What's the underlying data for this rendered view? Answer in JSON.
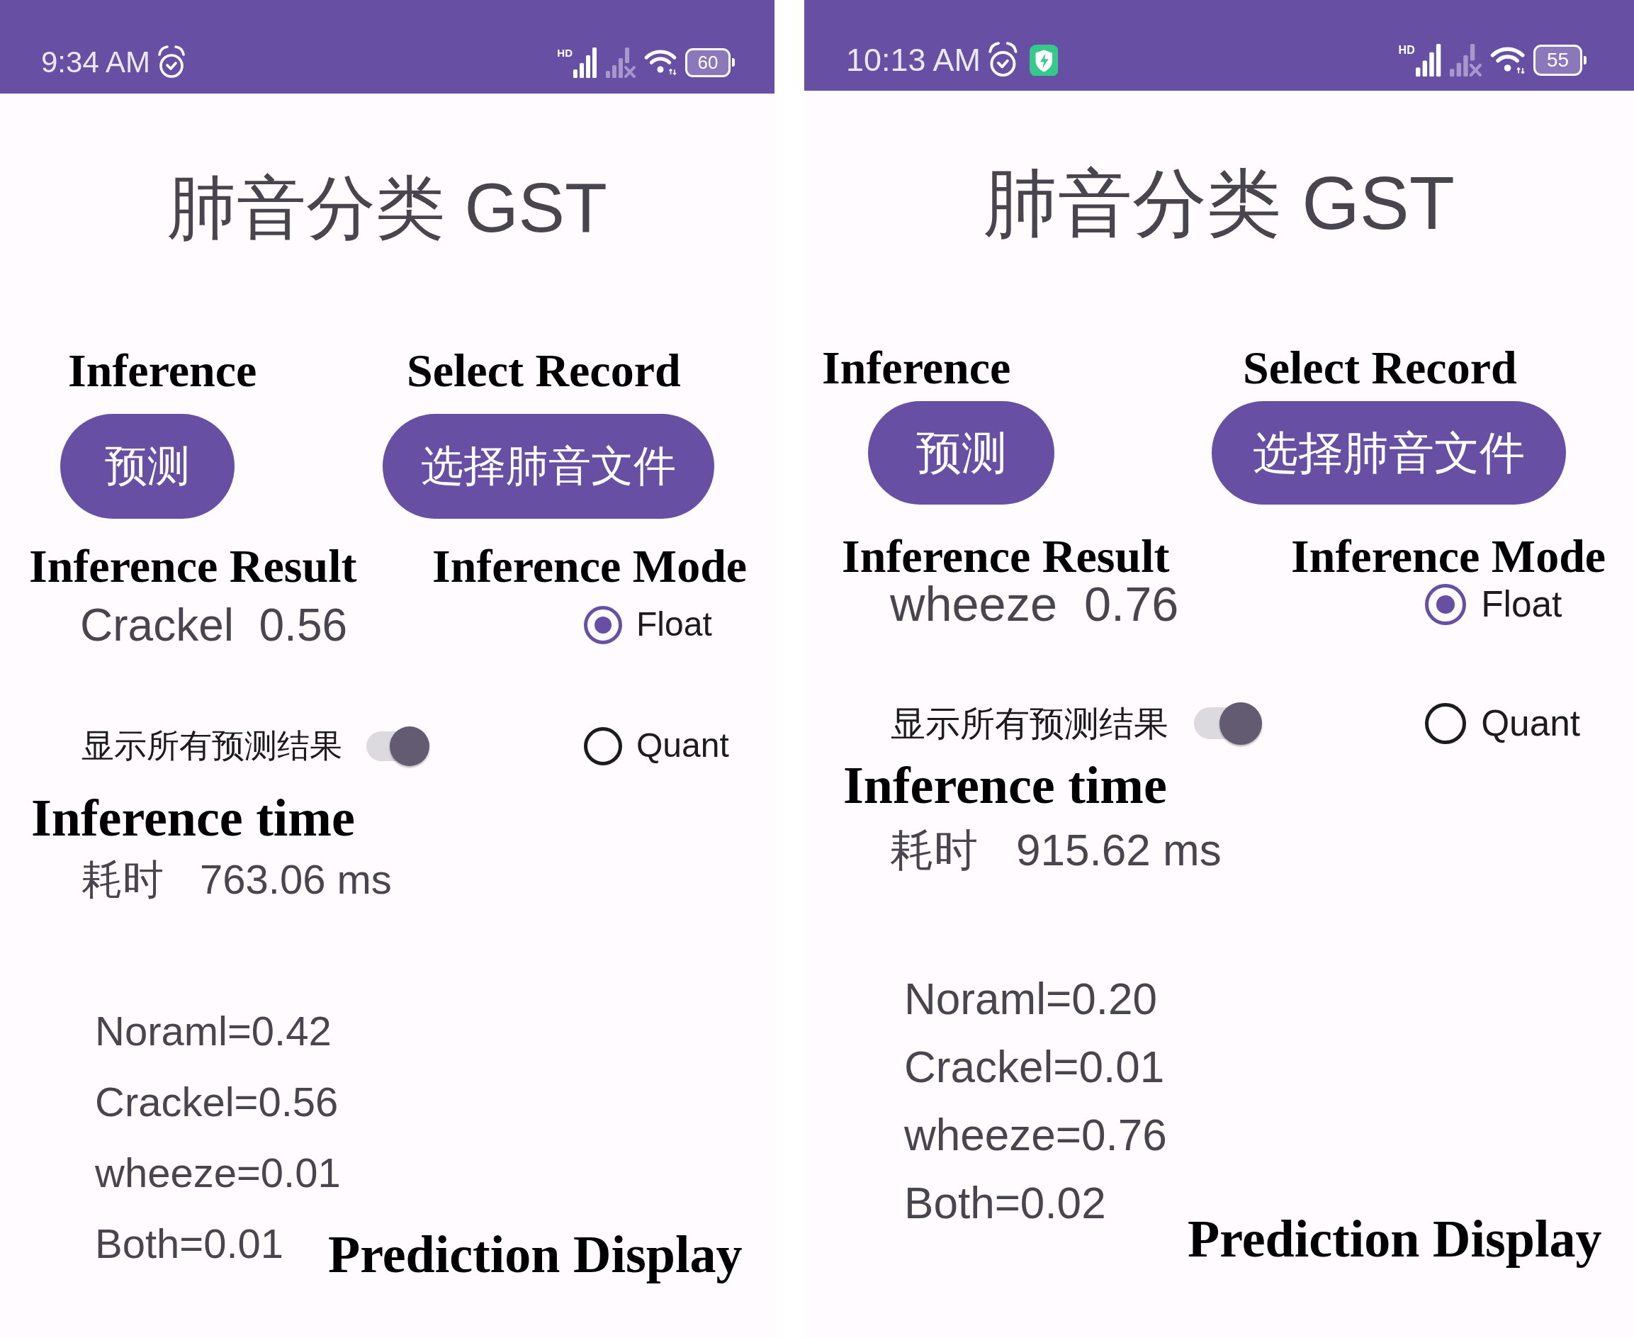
{
  "screens": [
    {
      "status_bar": {
        "time": "9:34 AM",
        "notification_icons": [
          {
            "kind": "alarm"
          }
        ],
        "network": "HD",
        "battery": "60"
      },
      "app_title": "肺音分类 GST",
      "inference": {
        "caption": "Inference",
        "button": "预测"
      },
      "select_record": {
        "caption": "Select Record",
        "button": "选择肺音文件"
      },
      "result": {
        "caption": "Inference Result",
        "value": "Crackel  0.56"
      },
      "mode": {
        "caption": "Inference Mode",
        "options": [
          {
            "label": "Float",
            "selected": true
          },
          {
            "label": "Quant",
            "selected": false
          }
        ]
      },
      "show_all": {
        "label": "显示所有预测结果",
        "on": true
      },
      "timing": {
        "caption": "Inference time",
        "label": "耗时",
        "value": "763.06 ms"
      },
      "predictions": {
        "lines": [
          "Noraml=0.42",
          "Crackel=0.56",
          "wheeze=0.01",
          "Both=0.01"
        ],
        "caption": "Prediction Display"
      }
    },
    {
      "status_bar": {
        "time": "10:13 AM",
        "notification_icons": [
          {
            "kind": "alarm"
          },
          {
            "kind": "shield"
          }
        ],
        "network": "HD",
        "battery": "55"
      },
      "app_title": "肺音分类 GST",
      "inference": {
        "caption": "Inference",
        "button": "预测"
      },
      "select_record": {
        "caption": "Select Record",
        "button": "选择肺音文件"
      },
      "result": {
        "caption": "Inference Result",
        "value": "wheeze  0.76"
      },
      "mode": {
        "caption": "Inference Mode",
        "options": [
          {
            "label": "Float",
            "selected": true
          },
          {
            "label": "Quant",
            "selected": false
          }
        ]
      },
      "show_all": {
        "label": "显示所有预测结果",
        "on": true
      },
      "timing": {
        "caption": "Inference time",
        "label": "耗时",
        "value": "915.62 ms"
      },
      "predictions": {
        "lines": [
          "Noraml=0.20",
          "Crackel=0.01",
          "wheeze=0.76",
          "Both=0.02"
        ],
        "caption": "Prediction Display"
      }
    }
  ]
}
